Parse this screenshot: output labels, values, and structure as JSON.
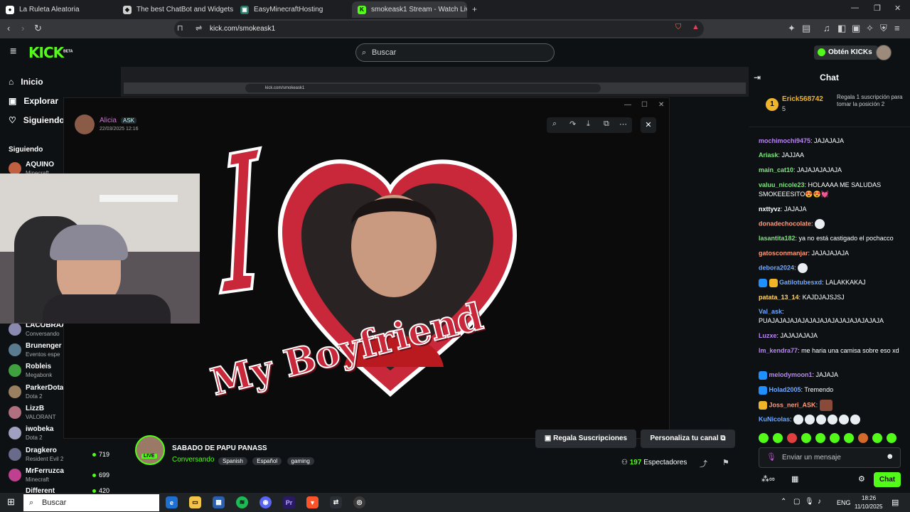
{
  "browser": {
    "tabs": [
      {
        "label": "La Ruleta Aleatoria"
      },
      {
        "label": "The best ChatBot and Widgets for Ki"
      },
      {
        "label": "EasyMinecraftHosting"
      },
      {
        "label": "smokeask1 Stream - Watch Live"
      }
    ],
    "url": "kick.com/smokeask1"
  },
  "kick": {
    "logo": "KICK",
    "logo_badge": "BETA",
    "search_placeholder": "Buscar",
    "get_kicks": "Obtén KICKs"
  },
  "sidebar": {
    "nav": [
      {
        "label": "Inicio"
      },
      {
        "label": "Explorar"
      },
      {
        "label": "Siguiendo"
      }
    ],
    "following_header": "Siguiendo",
    "channels": [
      {
        "name": "AQUINO",
        "game": "Minecraft",
        "viewers": "",
        "color": "#c06040"
      },
      {
        "name": "LACOBRAA",
        "game": "Conversando",
        "viewers": "",
        "color": "#8a8ab0"
      },
      {
        "name": "Brunenger",
        "game": "Eventos espe",
        "viewers": "",
        "color": "#5a7a90"
      },
      {
        "name": "Robleis",
        "game": "Megabonk",
        "viewers": "",
        "color": "#40a040"
      },
      {
        "name": "ParkerDota",
        "game": "Dota 2",
        "viewers": "",
        "color": "#9a8060"
      },
      {
        "name": "LizzB",
        "game": "VALORANT",
        "viewers": "",
        "color": "#b07080"
      },
      {
        "name": "iwobeka",
        "game": "Dota 2",
        "viewers": "",
        "color": "#a0a0c0"
      },
      {
        "name": "Dragkero",
        "game": "Resident Evil 2",
        "viewers": "719",
        "color": "#6a6a8a"
      },
      {
        "name": "MrFerruzca",
        "game": "Minecraft",
        "viewers": "699",
        "color": "#c04090"
      },
      {
        "name": "Different",
        "game": "",
        "viewers": "420",
        "color": "#506070"
      }
    ]
  },
  "stream": {
    "title": "SABADO DE PAPU PANASS",
    "category": "Conversando",
    "tags": [
      "Spanish",
      "Español",
      "gaming"
    ],
    "live_badge": "LIVE",
    "subs_button": "Regala Suscripciones",
    "customize_button": "Personaliza tu canal",
    "viewers_count": "197",
    "viewers_label": "Espectadores"
  },
  "popup": {
    "author": "Alicia",
    "badge": "ASK",
    "date": "22/03/2025 12:16",
    "image_text": {
      "big_letter": "I",
      "caption": "My Boyfriend"
    }
  },
  "chat": {
    "title": "Chat",
    "pinned": {
      "user": "Erick568742",
      "rank": "1",
      "count": "5",
      "text": "Regala 1 suscripción para tomar la posición 2"
    },
    "messages": [
      {
        "user": "mochimochi9475",
        "color": "#b985f5",
        "text": "JAJAJAJA"
      },
      {
        "user": "Ariask",
        "color": "#7fe17f",
        "text": "JAJJAA"
      },
      {
        "user": "main_cat10",
        "color": "#7fe17f",
        "text": "JAJAJAJAJAJA"
      },
      {
        "user": "valuu_nicole23",
        "color": "#7fe17f",
        "text": "HOLAAAA ME SALUDAS SMOKEEESITO😍😍💓"
      },
      {
        "user": "nxttyvz",
        "color": "#ffffff",
        "text": "JAJAJA"
      },
      {
        "user": "donadechocolate",
        "color": "#ff9a7a",
        "text": ""
      },
      {
        "user": "lasantita182",
        "color": "#7fe17f",
        "text": "ya no está castigado el pochacco"
      },
      {
        "user": "gatosconmanjar",
        "color": "#ff9a7a",
        "text": "JAJAJAJAJA"
      },
      {
        "user": "debora2024",
        "color": "#6fa8ff",
        "text": ""
      },
      {
        "user": "Gatilotubesxd",
        "color": "#6fa8ff",
        "text": "LALAKKAKAJ"
      },
      {
        "user": "patata_13_14",
        "color": "#ffd66a",
        "text": "KAJDJAJSJSJ"
      },
      {
        "user": "Val_ask",
        "color": "#6fa8ff",
        "text": "PUAJAJAJAJAJAJAJAJAJAJAJAJAJAJAJA"
      },
      {
        "user": "Luzxe",
        "color": "#b985f5",
        "text": "JAJAJAJAJA"
      },
      {
        "user": "lm_kendra77",
        "color": "#b985f5",
        "text": "me haria una camisa sobre eso xd"
      },
      {
        "user": "melodymoon1",
        "color": "#b985f5",
        "text": "JAJAJA"
      },
      {
        "user": "Holad2005",
        "color": "#6fa8ff",
        "text": "Tremendo"
      },
      {
        "user": "Joss_neri_ASK",
        "color": "#ff9a7a",
        "text": ""
      },
      {
        "user": "KuNicolas",
        "color": "#6fa8ff",
        "text": ""
      }
    ],
    "input_placeholder": "Enviar un mensaje",
    "send_button": "Chat"
  },
  "taskbar": {
    "search": "Buscar",
    "lang": "ENG",
    "time": "18:26",
    "date": "11/10/2025"
  }
}
